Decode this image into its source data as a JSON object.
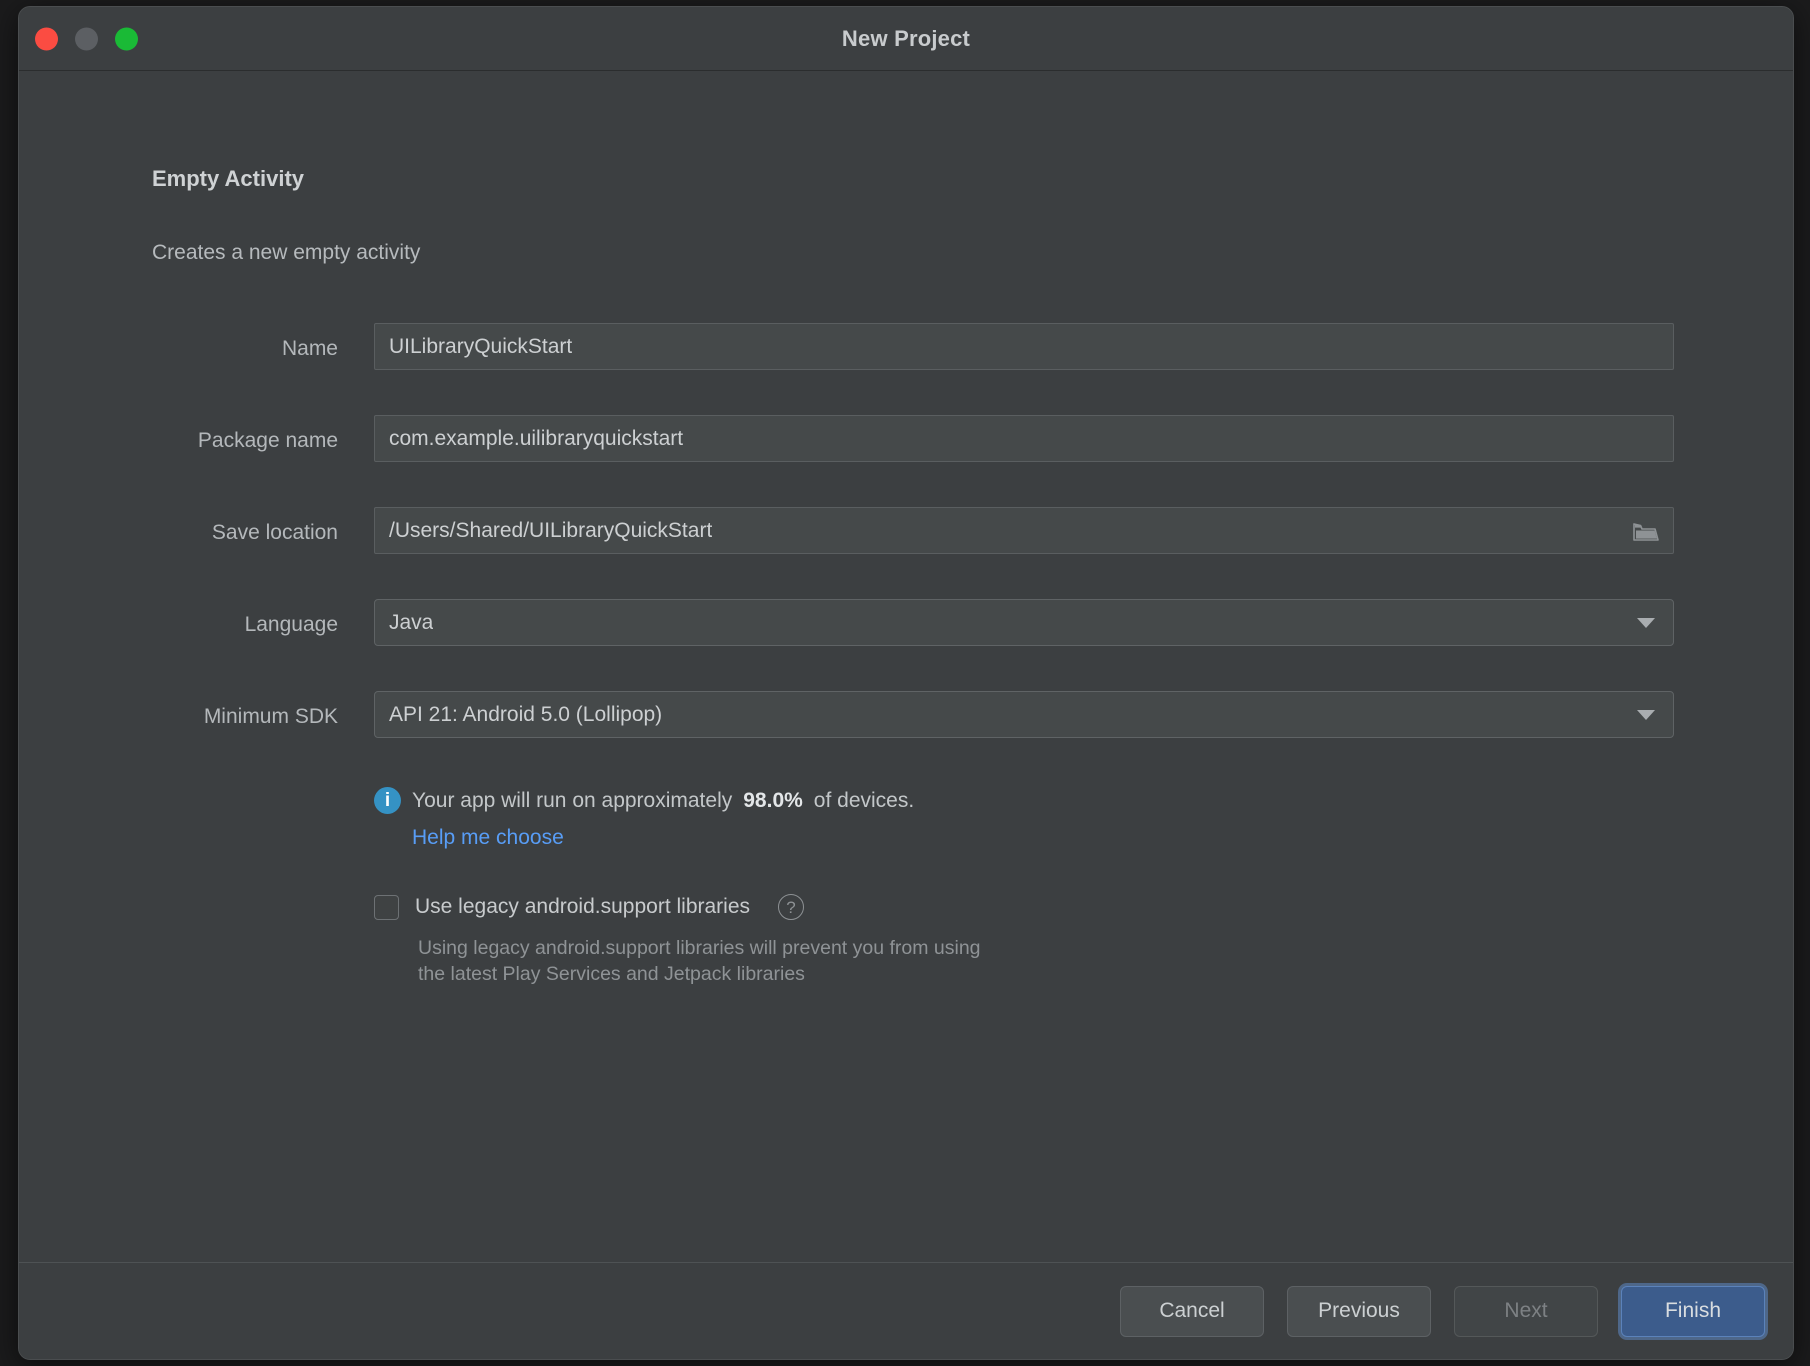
{
  "window": {
    "title": "New Project",
    "traffic_lights": [
      {
        "name": "close-button",
        "color": "#fb4c42"
      },
      {
        "name": "minimize-button",
        "color": "#5c5f63"
      },
      {
        "name": "zoom-button",
        "color": "#1aba36"
      }
    ]
  },
  "page": {
    "heading": "Empty Activity",
    "subheading": "Creates a new empty activity"
  },
  "form": {
    "fields": [
      {
        "key": "name",
        "label": "Name",
        "value": "UILibraryQuickStart",
        "type": "text"
      },
      {
        "key": "package_name",
        "label": "Package name",
        "value": "com.example.uilibraryquickstart",
        "type": "text"
      },
      {
        "key": "save_location",
        "label": "Save location",
        "value": "/Users/Shared/UILibraryQuickStart",
        "type": "text-with-browse",
        "trailing_icon": "folder-icon"
      },
      {
        "key": "language",
        "label": "Language",
        "value": "Java",
        "type": "combo",
        "trailing_icon": "chevron-down-icon"
      },
      {
        "key": "minimum_sdk",
        "label": "Minimum SDK",
        "value": "API 21: Android 5.0 (Lollipop)",
        "type": "combo",
        "trailing_icon": "chevron-down-icon"
      }
    ]
  },
  "info": {
    "icon": "info-icon",
    "text_before": "Your app will run on approximately",
    "percent": "98.0%",
    "text_after": "of devices.",
    "link_label": "Help me choose",
    "link_color": "#589df6"
  },
  "legacy": {
    "checkbox_label": "Use legacy android.support libraries",
    "checked": false,
    "help_icon": "question-mark-icon",
    "description_line_1": "Using legacy android.support libraries will prevent you from using",
    "description_line_2": "the latest Play Services and Jetpack libraries"
  },
  "footer": {
    "buttons": [
      {
        "key": "cancel",
        "label": "Cancel",
        "state": "enabled"
      },
      {
        "key": "previous",
        "label": "Previous",
        "state": "enabled"
      },
      {
        "key": "next",
        "label": "Next",
        "state": "disabled"
      },
      {
        "key": "finish",
        "label": "Finish",
        "state": "primary-focused"
      }
    ]
  },
  "colors": {
    "window_bg": "#3c3f41",
    "field_bg": "#45494a",
    "accent_blue": "#3592c4",
    "primary_button": "#3c5c8c"
  }
}
